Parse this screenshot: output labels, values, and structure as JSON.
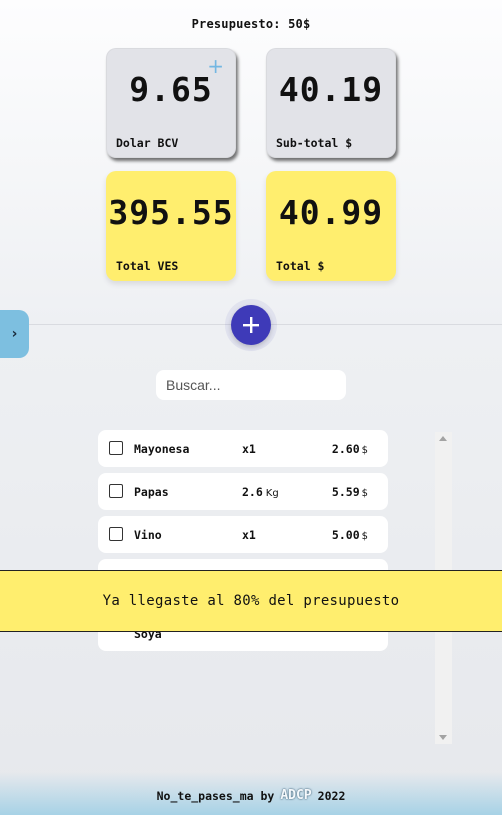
{
  "header": {
    "budget_text": "Presupuesto: 50$"
  },
  "cards": {
    "dolar_bcv": {
      "value": "9.65",
      "label": "Dolar BCV",
      "corner_icon": "plus-icon"
    },
    "subtotal": {
      "value": "40.19",
      "label": "Sub-total $"
    },
    "total_ves": {
      "value": "395.55",
      "label": "Total VES"
    },
    "total_usd": {
      "value": "40.99",
      "label": "Total $"
    }
  },
  "side_tab": {
    "icon": "chevron-right-icon",
    "glyph": "›"
  },
  "add_button": {
    "icon": "plus-icon"
  },
  "search": {
    "placeholder": "Buscar...",
    "value": ""
  },
  "items": [
    {
      "name": "Mayonesa",
      "qty": "x1",
      "unit": "",
      "price": "2.60",
      "currency": "$",
      "checked": false
    },
    {
      "name": "Papas",
      "qty": "2.6",
      "unit": "Kg",
      "price": "5.59",
      "currency": "$",
      "checked": false
    },
    {
      "name": "Vino",
      "qty": "x1",
      "unit": "",
      "price": "5.00",
      "currency": "$",
      "checked": false
    },
    {
      "name": "Soya",
      "qty": "",
      "unit": "",
      "price": "",
      "currency": "",
      "checked": false
    }
  ],
  "toast": {
    "message": "Ya llegaste al 80% del presupuesto"
  },
  "footer": {
    "app_name": "No_te_pases_ma",
    "by": "by",
    "brand": "ADCP",
    "year": "2022"
  },
  "colors": {
    "accent": "#3e3ab8",
    "card_yellow": "#ffee6e",
    "card_gray": "#e2e3e8",
    "side_tab": "#7dbfe0"
  }
}
